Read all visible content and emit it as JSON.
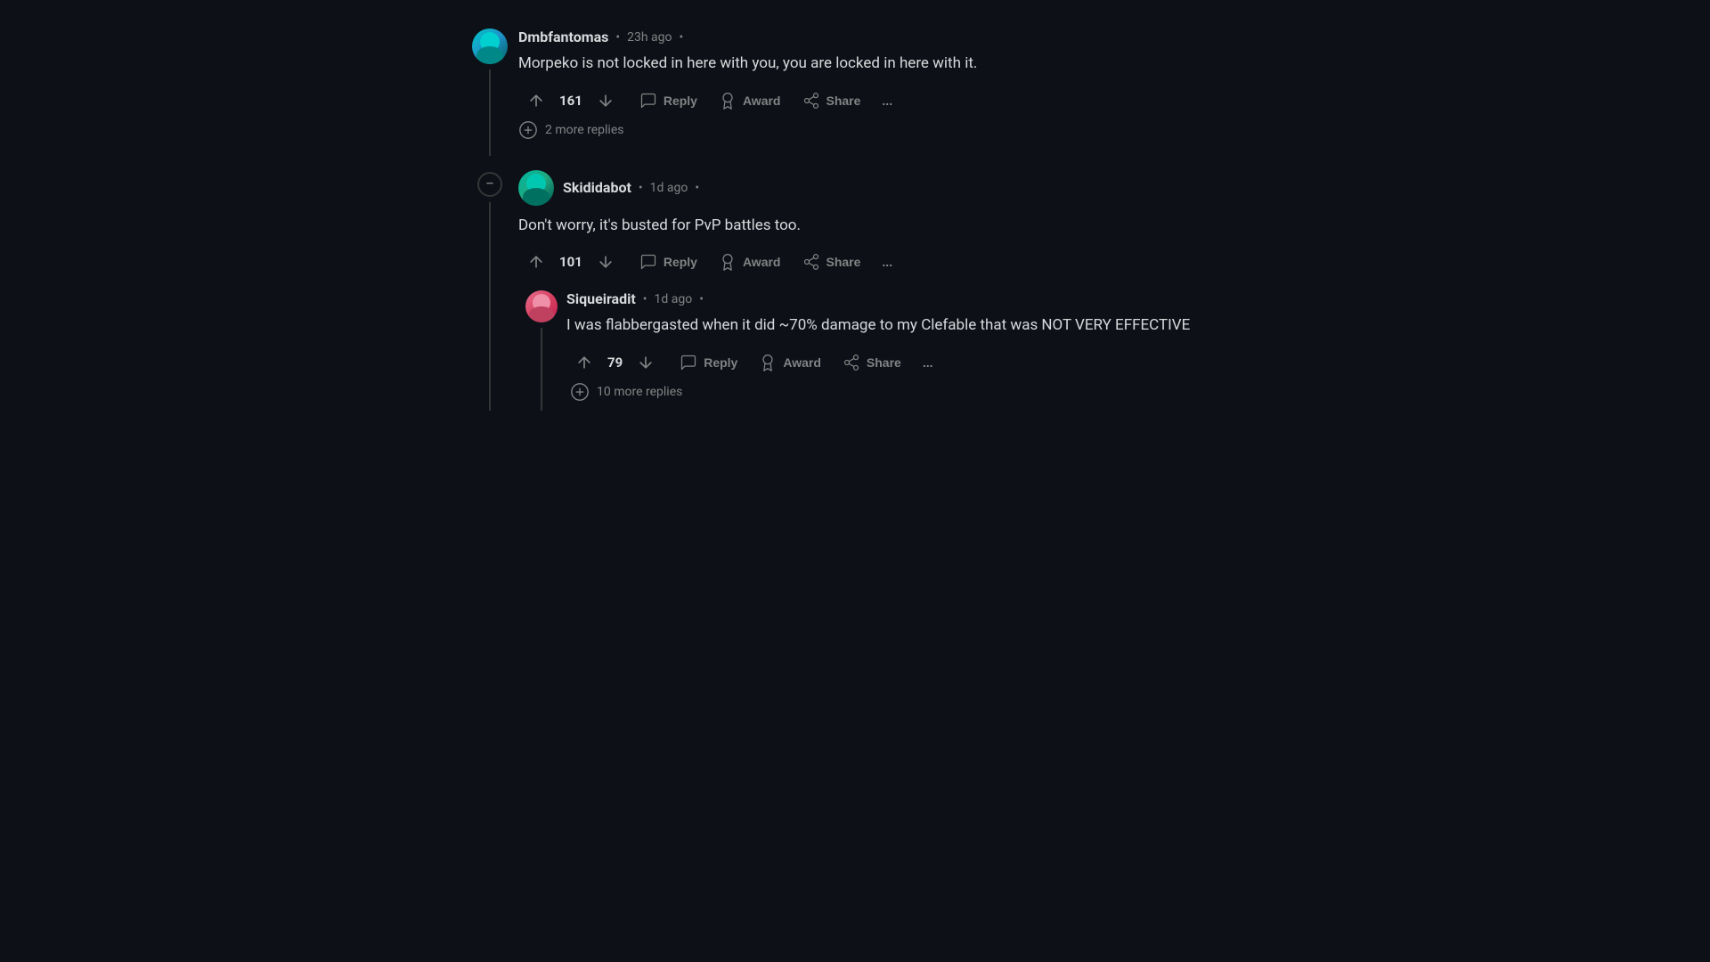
{
  "comments": [
    {
      "id": "comment1",
      "username": "Dmbfantomas",
      "timestamp": "23h ago",
      "text": "Morpeko is not locked in here with you, you are locked in here with it.",
      "upvotes": "161",
      "avatarClass": "avatar-dmbfantomas",
      "moreReplies": "2 more replies",
      "replies": []
    },
    {
      "id": "comment2",
      "username": "Skididabot",
      "timestamp": "1d ago",
      "text": "Don't worry, it's busted for PvP battles too.",
      "upvotes": "101",
      "avatarClass": "avatar-skididabot",
      "moreReplies": null,
      "replies": [
        {
          "id": "reply1",
          "username": "Siqueiradit",
          "timestamp": "1d ago",
          "text": "I was flabbergasted when it did ~70% damage to my Clefable that was NOT VERY EFFECTIVE",
          "upvotes": "79",
          "avatarClass": "avatar-siqueiradit",
          "moreReplies": "10 more replies"
        }
      ]
    }
  ],
  "actions": {
    "reply": "Reply",
    "award": "Award",
    "share": "Share",
    "more": "..."
  }
}
